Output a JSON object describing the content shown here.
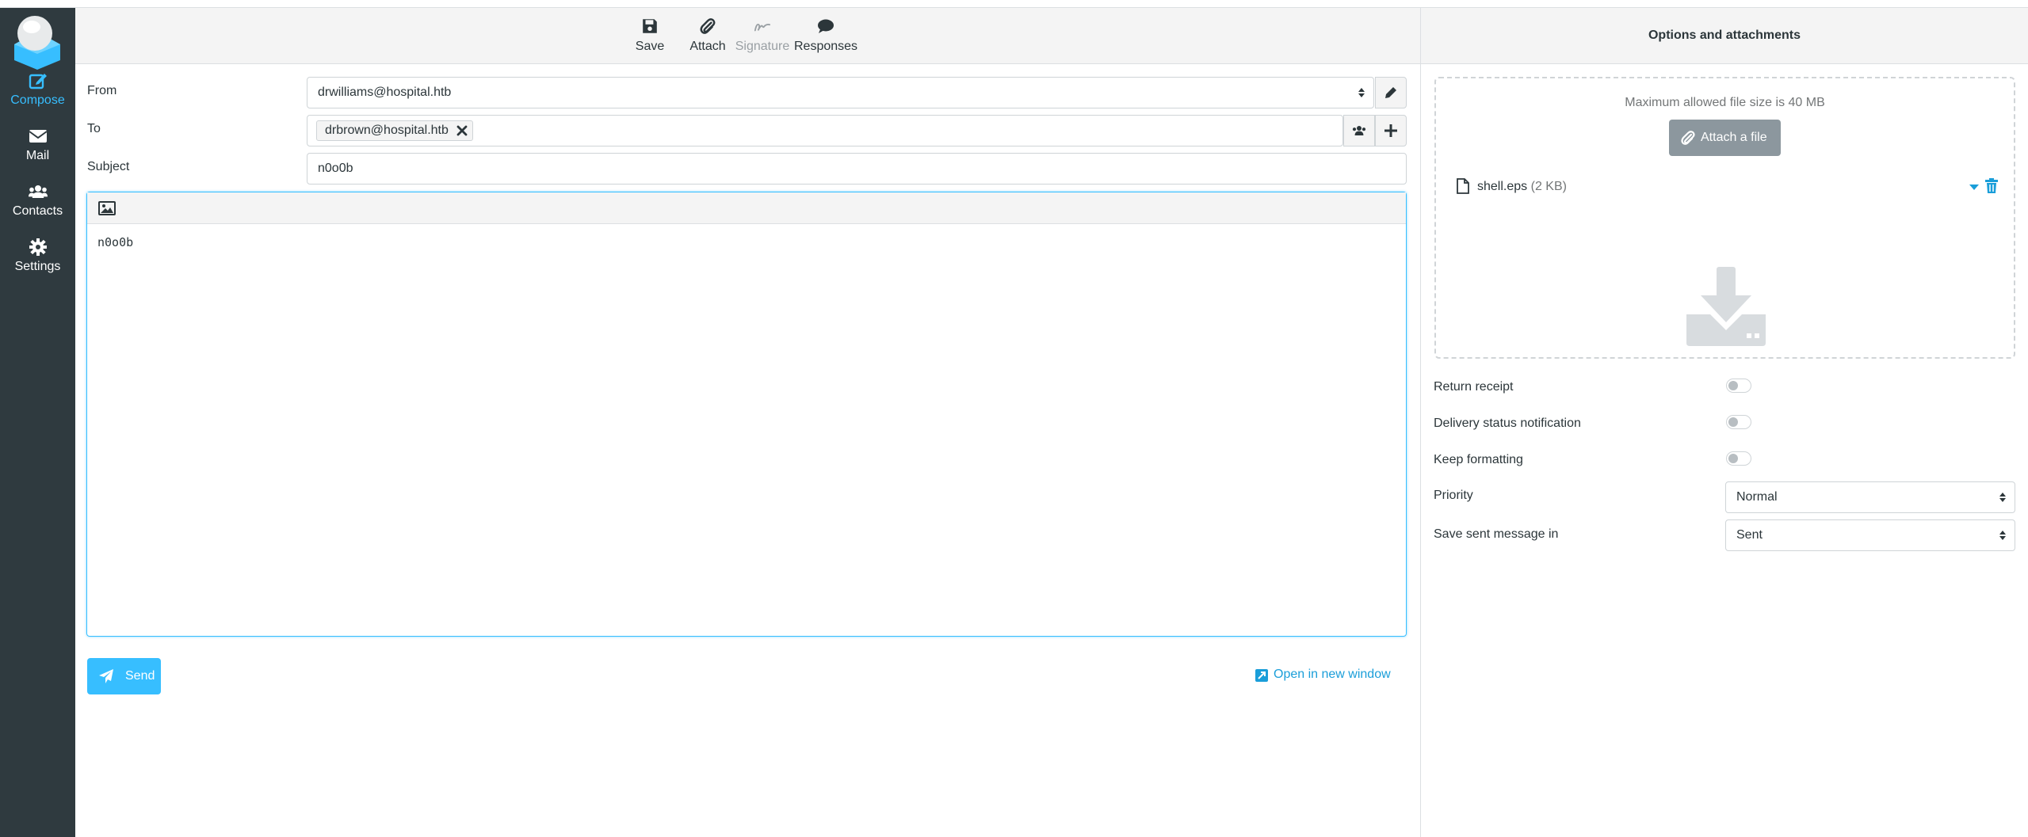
{
  "sidebar": {
    "items": [
      {
        "label": "Compose",
        "icon": "compose-icon"
      },
      {
        "label": "Mail",
        "icon": "envelope-icon"
      },
      {
        "label": "Contacts",
        "icon": "users-icon"
      },
      {
        "label": "Settings",
        "icon": "gear-icon"
      }
    ]
  },
  "toolbar": {
    "save_label": "Save",
    "attach_label": "Attach",
    "signature_label": "Signature",
    "responses_label": "Responses"
  },
  "right_header": {
    "title": "Options and attachments"
  },
  "compose": {
    "from_label": "From",
    "from_value": "drwilliams@hospital.htb",
    "to_label": "To",
    "to_recipients": [
      "drbrown@hospital.htb"
    ],
    "subject_label": "Subject",
    "subject_value": "n0o0b",
    "body": "n0o0b",
    "send_label": "Send",
    "open_new_label": "Open in new window"
  },
  "attachments": {
    "max_size_text": "Maximum allowed file size is 40 MB",
    "attach_button_label": "Attach a file",
    "files": [
      {
        "name": "shell.eps",
        "size": "(2 KB)"
      }
    ]
  },
  "options": {
    "return_receipt_label": "Return receipt",
    "return_receipt_on": false,
    "dsn_label": "Delivery status notification",
    "dsn_on": false,
    "keep_formatting_label": "Keep formatting",
    "keep_formatting_on": false,
    "priority_label": "Priority",
    "priority_value": "Normal",
    "save_sent_label": "Save sent message in",
    "save_sent_value": "Sent"
  },
  "colors": {
    "accent": "#37beff",
    "sidebar_bg": "#2f3a3f",
    "attach_button_bg": "#8c979e"
  }
}
